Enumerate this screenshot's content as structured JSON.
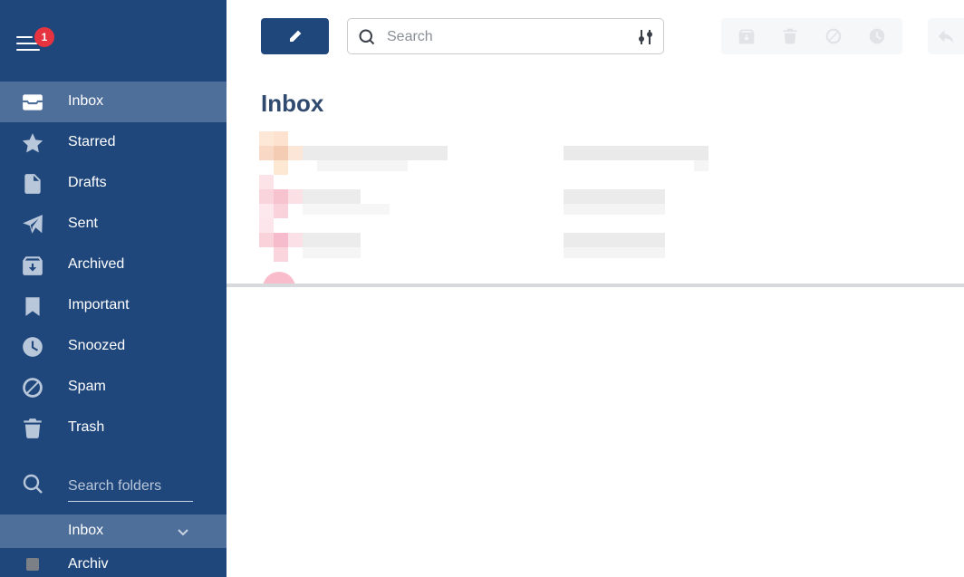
{
  "header": {
    "menu_icon": "hamburger-icon",
    "notification_count": "1"
  },
  "sidebar": {
    "items": [
      {
        "label": "Inbox",
        "icon": "inbox-icon",
        "active": true
      },
      {
        "label": "Starred",
        "icon": "star-icon"
      },
      {
        "label": "Drafts",
        "icon": "file-icon"
      },
      {
        "label": "Sent",
        "icon": "send-icon"
      },
      {
        "label": "Archived",
        "icon": "archive-icon"
      },
      {
        "label": "Important",
        "icon": "bookmark-icon"
      },
      {
        "label": "Snoozed",
        "icon": "clock-icon"
      },
      {
        "label": "Spam",
        "icon": "ban-icon"
      },
      {
        "label": "Trash",
        "icon": "trash-icon"
      }
    ],
    "folder_search_placeholder": "Search folders",
    "folders": [
      {
        "label": "Inbox",
        "expandable": true,
        "active": true
      },
      {
        "label": "Archiv",
        "color": "#7b7f86"
      }
    ]
  },
  "main": {
    "search_placeholder": "Search",
    "title": "Inbox"
  },
  "colors": {
    "sidebar_bg": "#1f477c",
    "sidebar_active": "#4f6f9b",
    "badge": "#e53340",
    "accent": "#1f477c"
  }
}
